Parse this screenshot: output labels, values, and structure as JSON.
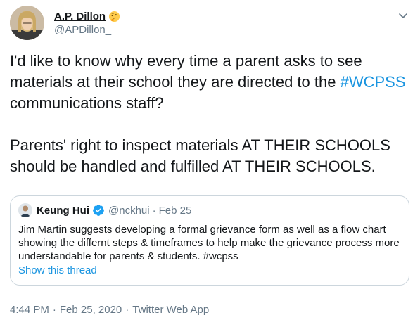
{
  "author": {
    "name": "A.P. Dillon",
    "handle": "@APDillon_",
    "emoji_icon": "thinking-face-icon"
  },
  "tweet": {
    "line1_pre": "I'd like to know why every time a parent asks to see materials at their school they are directed to the ",
    "hashtag": "#WCPSS",
    "line1_post": " communications staff?",
    "paragraph2": "Parents' right to inspect materials AT THEIR SCHOOLS should be handled and fulfilled AT THEIR SCHOOLS."
  },
  "quote": {
    "name": "Keung Hui",
    "verified_icon": "verified-badge-icon",
    "handle": "@nckhui",
    "dot": "·",
    "date": "Feb 25",
    "text": "Jim Martin suggests developing a formal grievance form as well as a flow chart showing the differnt steps & timeframes to help make the grievance process more understandable for parents & students. #wcpss",
    "thread_link": "Show this thread"
  },
  "meta": {
    "time": "4:44 PM",
    "sep1": "·",
    "date": "Feb 25, 2020",
    "sep2": "·",
    "app": "Twitter Web App"
  },
  "colors": {
    "link": "#1b95e0",
    "secondary": "#657786",
    "border": "#ccd6dd",
    "text": "#14171a"
  }
}
